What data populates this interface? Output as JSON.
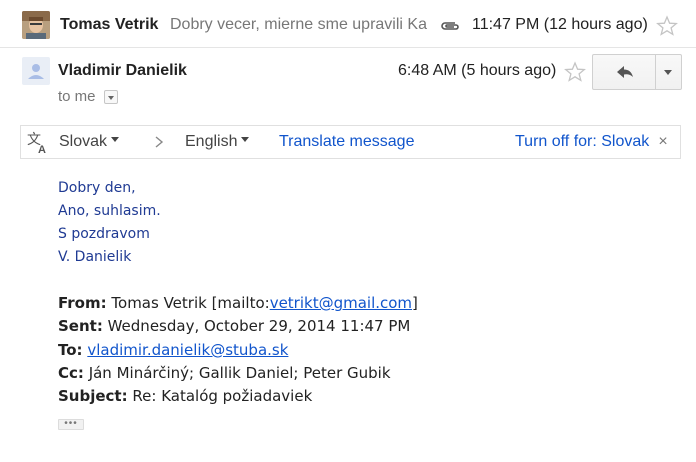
{
  "collapsed_message": {
    "sender": "Tomas Vetrik",
    "snippet": "Dobry vecer, mierne sme upravili Ka",
    "time": "11:47 PM (12 hours ago)",
    "attachment_icon": "paperclip-icon",
    "star_icon": "star-outline-icon"
  },
  "expanded_message": {
    "sender": "Vladimir Danielik",
    "recipient_summary": "to me",
    "time": "6:48 AM (5 hours ago)",
    "reply_icon": "reply-arrow-icon",
    "more_icon": "chevron-down-icon"
  },
  "translate_bar": {
    "from_language": "Slovak",
    "to_language": "English",
    "translate_link": "Translate message",
    "turn_off_link": "Turn off for: Slovak",
    "close_glyph": "×"
  },
  "body": {
    "lines": [
      "Dobry den,",
      "Ano, suhlasim.",
      "S pozdravom",
      "V. Danielik"
    ]
  },
  "quoted_header": {
    "from_label": "From:",
    "from_name": "Tomas Vetrik [mailto:",
    "from_email": "vetrikt@gmail.com",
    "from_close": "]",
    "sent_label": "Sent:",
    "sent_value": "Wednesday, October 29, 2014 11:47 PM",
    "to_label": "To:",
    "to_value": "vladimir.danielik@stuba.sk",
    "cc_label": "Cc:",
    "cc_value": "Ján Minárčiný; Gallik Daniel; Peter Gubik",
    "subject_label": "Subject:",
    "subject_value": "Re: Katalóg požiadaviek"
  },
  "trimmed_content_glyph": "•••",
  "colors": {
    "link": "#1155cc",
    "body_text": "#1f3a93",
    "muted": "#777777"
  }
}
